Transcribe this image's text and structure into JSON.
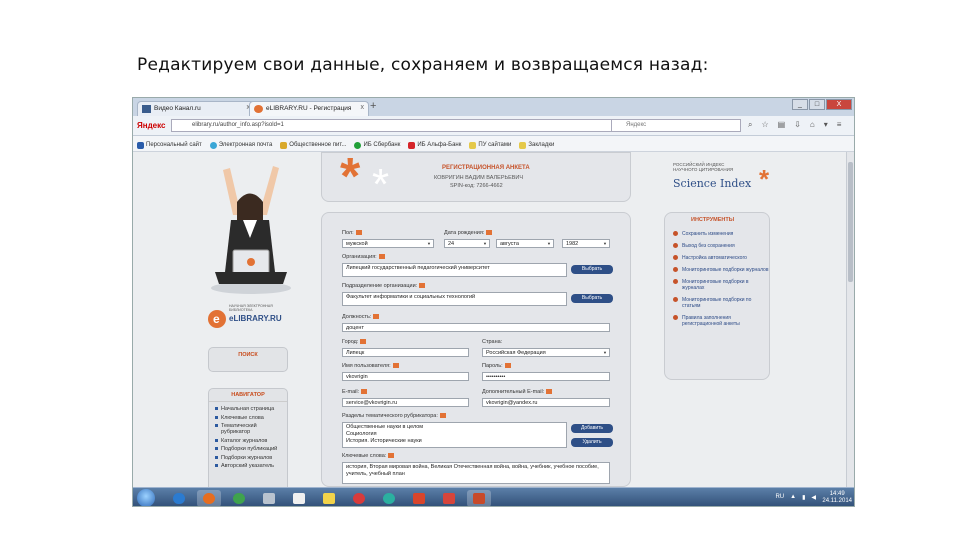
{
  "slide_title": "Редактируем свои данные, сохраняем и  возвращаемся назад:",
  "browser": {
    "tabs": [
      {
        "label": "Видео Канал.ru",
        "close": "x"
      },
      {
        "label": "eLIBRARY.RU - Регистрация",
        "close": "x"
      }
    ],
    "new_tab": "+",
    "window_buttons": {
      "minimize": "_",
      "maximize": "□",
      "close": "X"
    },
    "yandex_logo": "Яндекс",
    "url": "elibrary.ru/author_info.asp?isold=1",
    "search_placeholder": "Яндекс",
    "bookmarks": [
      "Персональный сайт",
      "Электронная почта",
      "Общественное пит...",
      "ИБ Сбербанк",
      "ИБ Альфа-Банк",
      "ПУ сайтами",
      "Закладки"
    ]
  },
  "page": {
    "header": {
      "title": "РЕГИСТРАЦИОННАЯ АНКЕТА",
      "name": "КОВРИГИН ВАДИМ ВАЛЕРЬЕВИЧ",
      "spin": "SPIN-код: 7266-4662"
    },
    "science_index": {
      "caption": "РОССИЙСКИЙ ИНДЕКС НАУЧНОГО ЦИТИРОВАНИЯ",
      "name": "Science Index"
    },
    "elibrary_logo": {
      "caption": "НАУЧНАЯ ЭЛЕКТРОННАЯ БИБЛИОТЕКА",
      "name": "eLIBRARY.RU"
    },
    "search_block_title": "ПОИСК",
    "navigator": {
      "title": "НАВИГАТОР",
      "items": [
        "Начальная страница",
        "Ключевые слова",
        "Тематический рубрикатор",
        "Каталог журналов",
        "Подборки публикаций",
        "Подборки журналов",
        "Авторский указатель"
      ]
    },
    "tools": {
      "title": "ИНСТРУМЕНТЫ",
      "items": [
        "Сохранить изменения",
        "Выход без сохранения",
        "Настройка автоматического",
        "Мониторинговые подборки журналов",
        "Мониторинговые подборки в журналах",
        "Мониторинговые подборки по статьям",
        "Правила заполнения регистрационной анкеты"
      ]
    },
    "form": {
      "gender": {
        "label": "Пол:",
        "value": "мужской"
      },
      "birth": {
        "label": "Дата рождения:",
        "day": "24",
        "month": "августа",
        "year": "1982"
      },
      "organization": {
        "label": "Организация:",
        "value": "Липецкий государственный педагогический университет",
        "button": "Выбрать"
      },
      "department": {
        "label": "Подразделение организации:",
        "value": "Факультет информатики и социальных технологий",
        "button": "Выбрать"
      },
      "position": {
        "label": "Должность:",
        "value": "доцент"
      },
      "city": {
        "label": "Город:",
        "value": "Липецк"
      },
      "country": {
        "label": "Страна:",
        "value": "Российская Федерация"
      },
      "login": {
        "label": "Имя пользователя:",
        "value": "vkovrigin"
      },
      "password": {
        "label": "Пароль:",
        "value": "••••••••••"
      },
      "email": {
        "label": "E-mail:",
        "value": "service@vkovrigin.ru"
      },
      "email2": {
        "label": "Дополнительный E-mail:",
        "value": "vkovrigin@yandex.ru"
      },
      "rubrics": {
        "label": "Разделы тематического рубрикатора:",
        "lines": [
          "Общественные науки в целом",
          "Социология",
          "История. Исторические науки"
        ],
        "add_button": "Добавить",
        "del_button": "Удалить"
      },
      "keywords": {
        "label": "Ключевые слова:",
        "value": "история, Вторая мировая война, Великая Отечественная война, война, учебник, учебное пособие, учитель, учебный план"
      }
    }
  },
  "taskbar": {
    "tray_lang": "RU",
    "time": "14:49",
    "date": "24.11.2014"
  }
}
